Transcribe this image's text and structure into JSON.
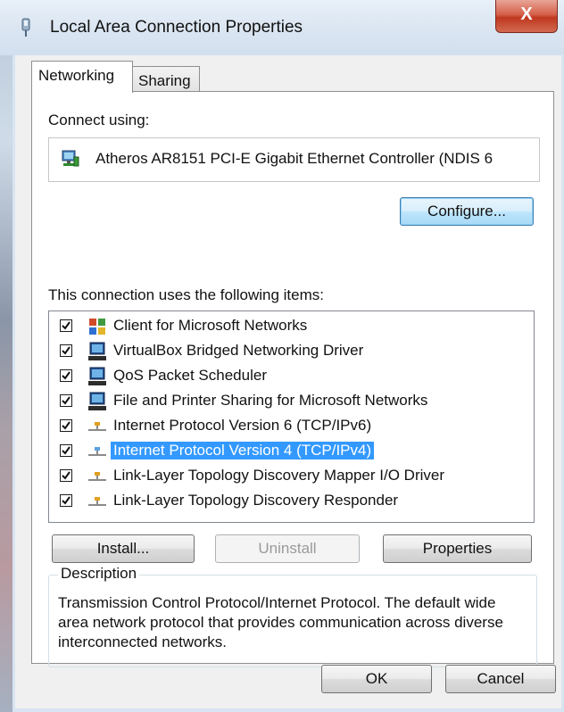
{
  "window": {
    "title": "Local Area Connection Properties",
    "close_label": "X"
  },
  "tabs": [
    {
      "label": "Networking"
    },
    {
      "label": "Sharing"
    }
  ],
  "connect_using": {
    "label": "Connect using:",
    "adapter": "Atheros AR8151 PCI-E Gigabit Ethernet Controller (NDIS 6"
  },
  "buttons": {
    "configure": "Configure...",
    "install": "Install...",
    "uninstall": "Uninstall",
    "properties": "Properties",
    "ok": "OK",
    "cancel": "Cancel"
  },
  "items_label": "This connection uses the following items:",
  "items": [
    {
      "label": "Client for Microsoft Networks",
      "checked": true,
      "icon": "network-client-icon"
    },
    {
      "label": "VirtualBox Bridged Networking Driver",
      "checked": true,
      "icon": "network-service-icon"
    },
    {
      "label": "QoS Packet Scheduler",
      "checked": true,
      "icon": "network-service-icon"
    },
    {
      "label": "File and Printer Sharing for Microsoft Networks",
      "checked": true,
      "icon": "network-service-icon"
    },
    {
      "label": "Internet Protocol Version 6 (TCP/IPv6)",
      "checked": true,
      "icon": "protocol-icon"
    },
    {
      "label": "Internet Protocol Version 4 (TCP/IPv4)",
      "checked": true,
      "icon": "protocol-icon",
      "selected": true
    },
    {
      "label": "Link-Layer Topology Discovery Mapper I/O Driver",
      "checked": true,
      "icon": "protocol-icon"
    },
    {
      "label": "Link-Layer Topology Discovery Responder",
      "checked": true,
      "icon": "protocol-icon"
    }
  ],
  "description": {
    "legend": "Description",
    "text": "Transmission Control Protocol/Internet Protocol. The default wide area network protocol that provides communication across diverse interconnected networks."
  },
  "colors": {
    "selection": "#3399ff",
    "close_button": "#c0381f"
  }
}
